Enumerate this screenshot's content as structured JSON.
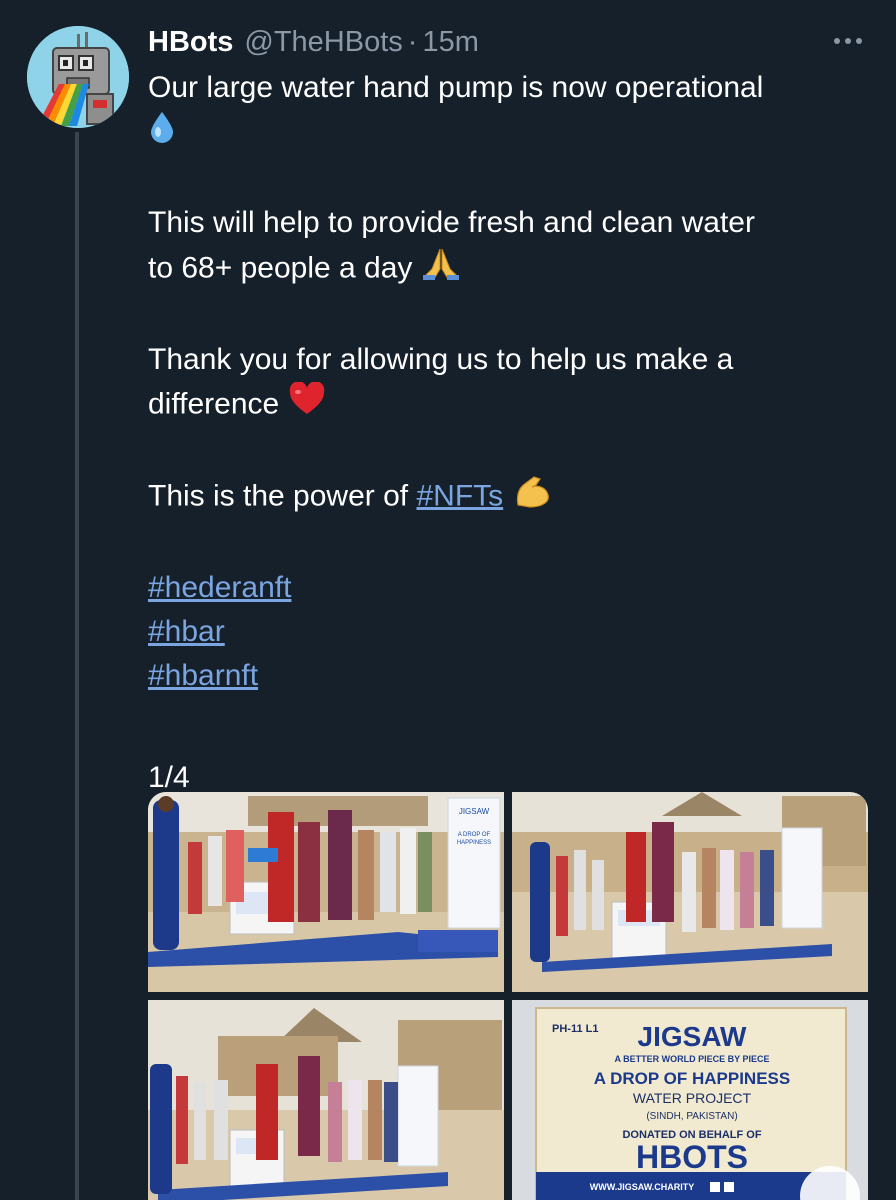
{
  "tweet": {
    "display_name": "HBots",
    "handle": "@TheHBots",
    "separator": "·",
    "time": "15m",
    "line1": "Our large water hand pump is now operational",
    "line2a": "This will help to provide fresh and clean water",
    "line2b": "to 68+ people a day",
    "line3a": "Thank you for allowing us to help us make a",
    "line3b": "difference",
    "line4": "This is the power of",
    "hashtag_nfts": "#NFTs",
    "hashtags": [
      "#hederanft",
      "#hbar",
      "#hbarnft"
    ],
    "counter": "1/4"
  },
  "media": {
    "banner_brand": "JIGSAW",
    "banner_line1": "A DROP OF",
    "banner_line2": "HAPPINESS",
    "sign": {
      "code": "PH-11 L1",
      "brand": "JIGSAW",
      "tagline": "A BETTER WORLD PIECE BY PIECE",
      "title": "A DROP OF HAPPINESS",
      "subtitle": "WATER PROJECT",
      "location": "(SINDH, PAKISTAN)",
      "donated": "DONATED ON BEHALF OF",
      "donor": "HBOTS",
      "website": "WWW.JIGSAW.CHARITY"
    }
  },
  "colors": {
    "background": "#15202b",
    "link": "#7aa5e0",
    "muted": "#8b98a5"
  },
  "icons": [
    "droplet-emoji",
    "folded-hands-emoji",
    "red-heart-emoji",
    "flexed-biceps-emoji",
    "more-options-icon"
  ]
}
